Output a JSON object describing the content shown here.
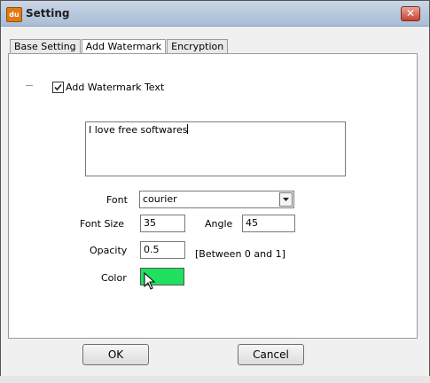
{
  "window": {
    "title": "Setting",
    "app_icon_text": "du"
  },
  "tabs": [
    {
      "label": "Base Setting"
    },
    {
      "label": "Add Watermark"
    },
    {
      "label": "Encryption"
    }
  ],
  "watermark": {
    "enable_label": "Add Watermark Text",
    "enabled": true,
    "text_value": "I love free softwares"
  },
  "font": {
    "label": "Font",
    "value": "courier"
  },
  "font_size": {
    "label": "Font Size",
    "value": "35"
  },
  "angle": {
    "label": "Angle",
    "value": "45"
  },
  "opacity": {
    "label": "Opacity",
    "value": "0.5",
    "hint": "[Between 0 and 1]"
  },
  "color": {
    "label": "Color",
    "value": "#20e060"
  },
  "buttons": {
    "ok": "OK",
    "cancel": "Cancel"
  },
  "colors": {
    "titlebar": "#b9cbe0",
    "close": "#c6422f",
    "swatch": "#20e060"
  }
}
